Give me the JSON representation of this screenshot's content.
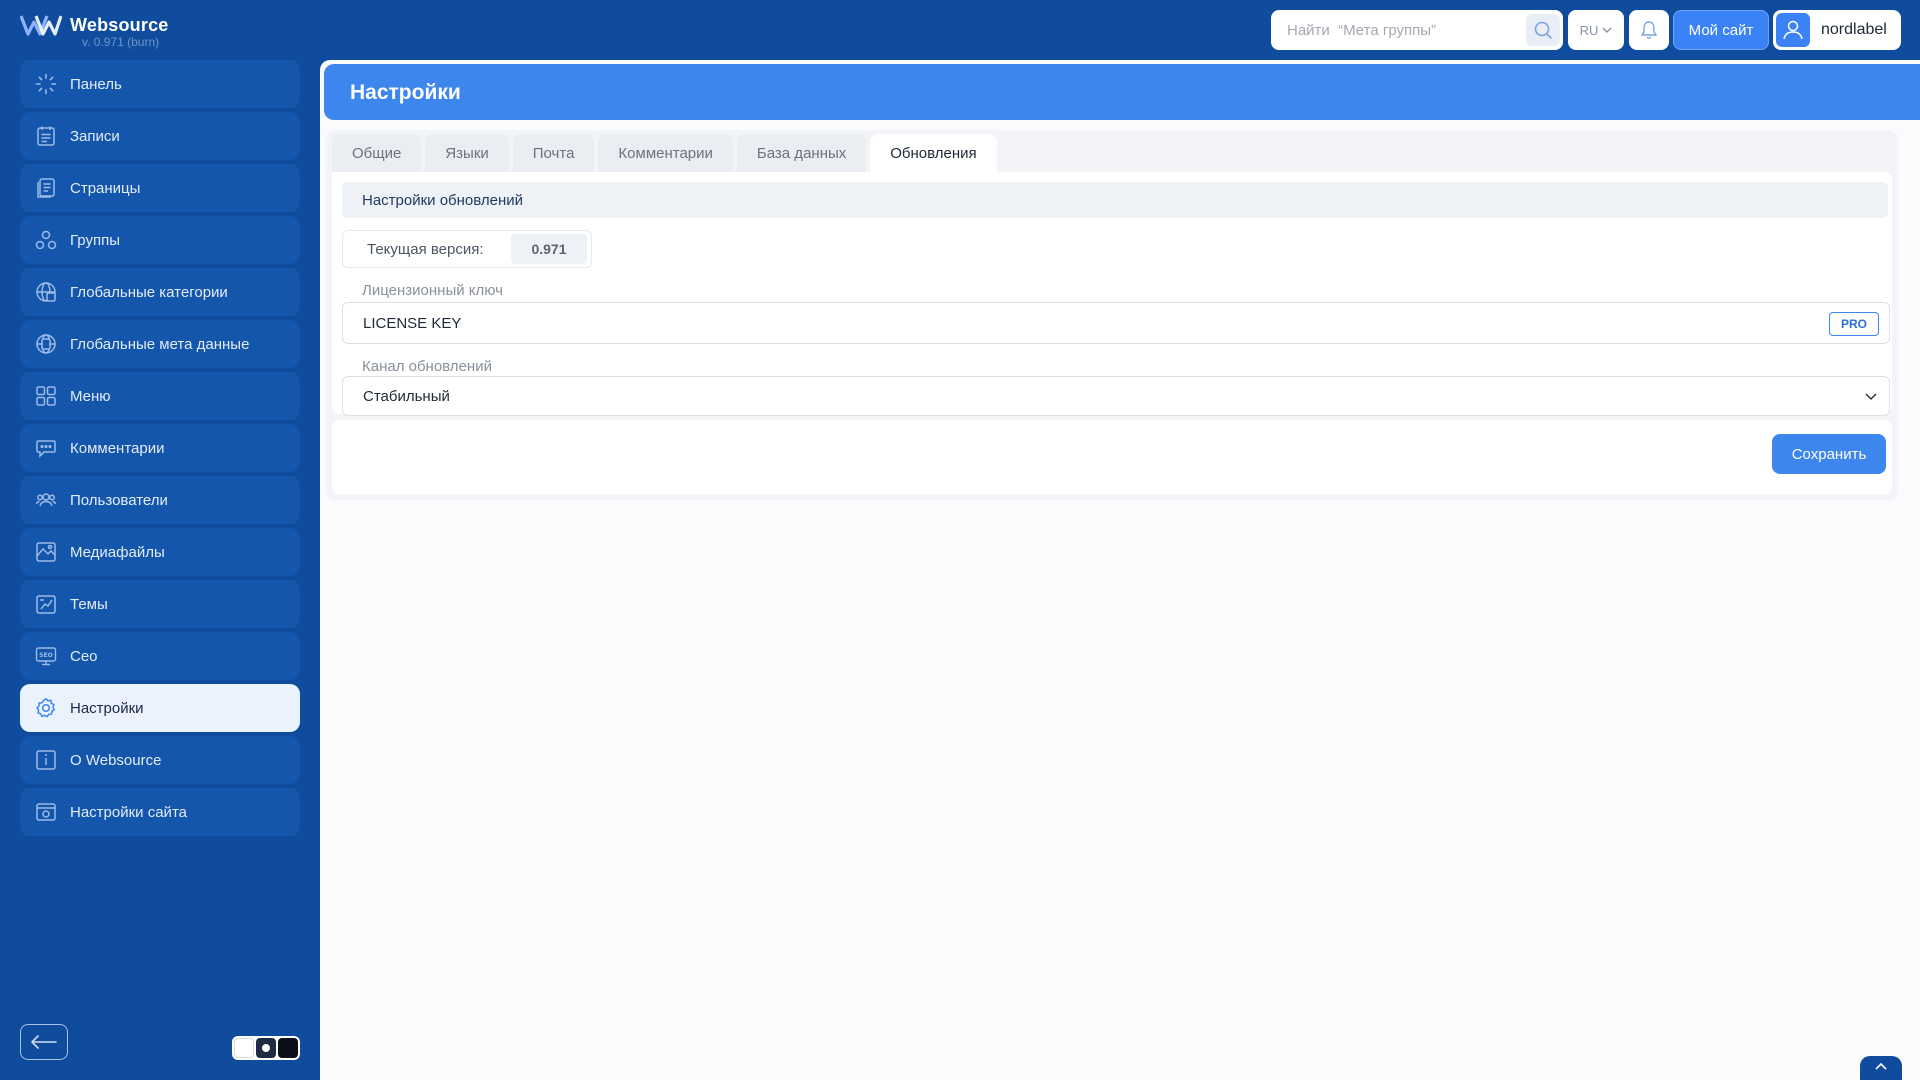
{
  "app": {
    "name": "Websource",
    "version": "v. 0.971 (burn)"
  },
  "topbar": {
    "search_placeholder": "Найти  “Мета группы”",
    "language": "RU",
    "mysite_label": "Мой сайт",
    "username": "nordlabel"
  },
  "sidebar": {
    "items": [
      {
        "label": "Панель",
        "icon": "dashboard-icon"
      },
      {
        "label": "Записи",
        "icon": "posts-icon"
      },
      {
        "label": "Страницы",
        "icon": "pages-icon"
      },
      {
        "label": "Группы",
        "icon": "groups-icon"
      },
      {
        "label": "Глобальные категории",
        "icon": "global-categories-icon"
      },
      {
        "label": "Глобальные мета данные",
        "icon": "global-meta-icon"
      },
      {
        "label": "Меню",
        "icon": "menu-grid-icon"
      },
      {
        "label": "Комментарии",
        "icon": "comments-icon"
      },
      {
        "label": "Пользователи",
        "icon": "users-icon"
      },
      {
        "label": "Медиафайлы",
        "icon": "media-icon"
      },
      {
        "label": "Темы",
        "icon": "themes-icon"
      },
      {
        "label": "Сео",
        "icon": "seo-icon"
      },
      {
        "label": "Настройки",
        "icon": "gear-icon",
        "active": true
      },
      {
        "label": "О Websource",
        "icon": "info-icon"
      },
      {
        "label": "Настройки сайта",
        "icon": "site-settings-icon"
      }
    ]
  },
  "page": {
    "title": "Настройки",
    "tabs": [
      {
        "label": "Общие"
      },
      {
        "label": "Языки"
      },
      {
        "label": "Почта"
      },
      {
        "label": "Комментарии"
      },
      {
        "label": "База данных"
      },
      {
        "label": "Обновления",
        "active": true
      }
    ],
    "section_title": "Настройки обновлений",
    "current_version_label": "Текущая версия:",
    "current_version_value": "0.971",
    "license_label": "Лицензионный ключ",
    "license_value": "LICENSE KEY",
    "license_badge": "PRO",
    "channel_label": "Канал обновлений",
    "channel_value": "Стабильный",
    "save_label": "Сохранить"
  },
  "colors": {
    "sidebar_bg": "#0f4c9e",
    "accent": "#3d86ee",
    "active_nav_bg": "#eaf2fe"
  }
}
